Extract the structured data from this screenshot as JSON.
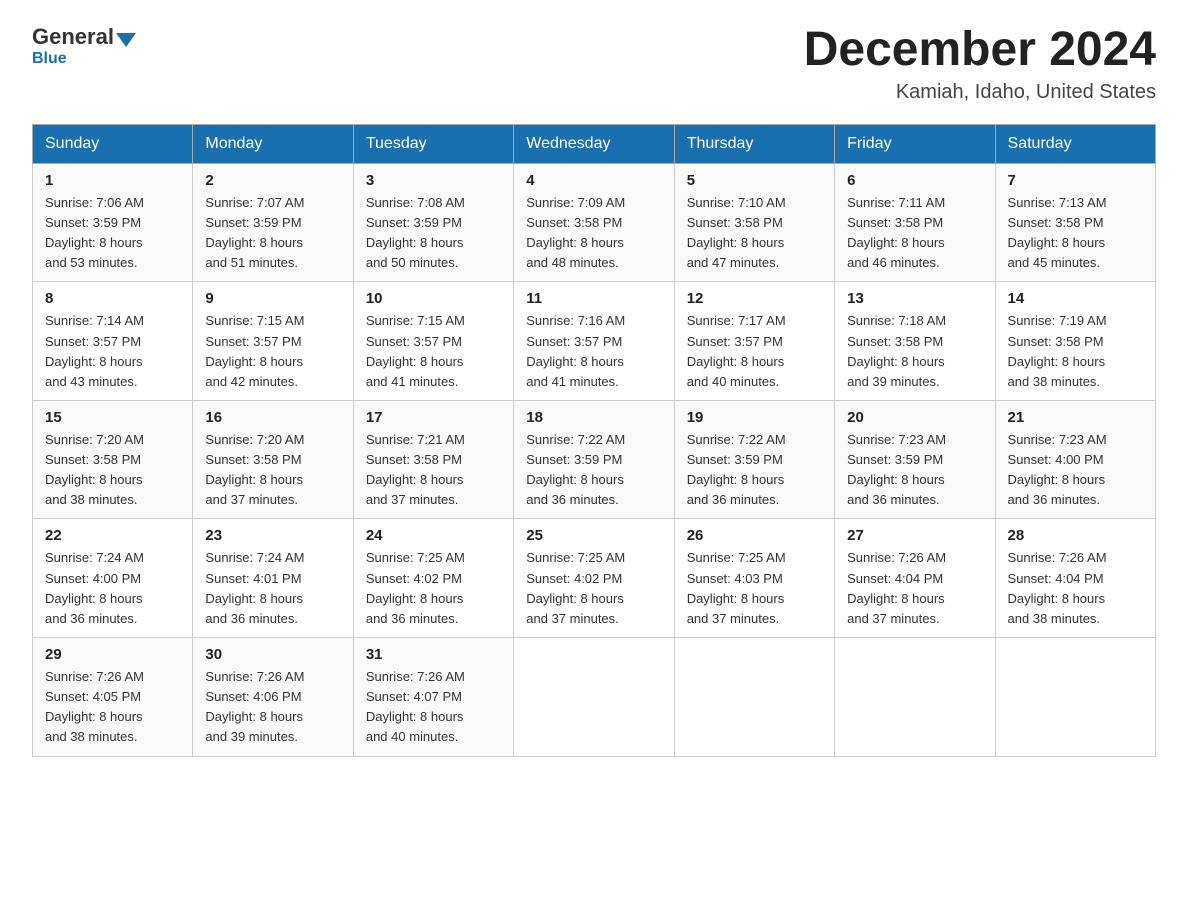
{
  "header": {
    "logo_text_general": "General",
    "logo_text_blue": "Blue",
    "month_title": "December 2024",
    "location": "Kamiah, Idaho, United States"
  },
  "days_of_week": [
    "Sunday",
    "Monday",
    "Tuesday",
    "Wednesday",
    "Thursday",
    "Friday",
    "Saturday"
  ],
  "weeks": [
    [
      {
        "day": "1",
        "sunrise": "7:06 AM",
        "sunset": "3:59 PM",
        "daylight": "8 hours and 53 minutes."
      },
      {
        "day": "2",
        "sunrise": "7:07 AM",
        "sunset": "3:59 PM",
        "daylight": "8 hours and 51 minutes."
      },
      {
        "day": "3",
        "sunrise": "7:08 AM",
        "sunset": "3:59 PM",
        "daylight": "8 hours and 50 minutes."
      },
      {
        "day": "4",
        "sunrise": "7:09 AM",
        "sunset": "3:58 PM",
        "daylight": "8 hours and 48 minutes."
      },
      {
        "day": "5",
        "sunrise": "7:10 AM",
        "sunset": "3:58 PM",
        "daylight": "8 hours and 47 minutes."
      },
      {
        "day": "6",
        "sunrise": "7:11 AM",
        "sunset": "3:58 PM",
        "daylight": "8 hours and 46 minutes."
      },
      {
        "day": "7",
        "sunrise": "7:13 AM",
        "sunset": "3:58 PM",
        "daylight": "8 hours and 45 minutes."
      }
    ],
    [
      {
        "day": "8",
        "sunrise": "7:14 AM",
        "sunset": "3:57 PM",
        "daylight": "8 hours and 43 minutes."
      },
      {
        "day": "9",
        "sunrise": "7:15 AM",
        "sunset": "3:57 PM",
        "daylight": "8 hours and 42 minutes."
      },
      {
        "day": "10",
        "sunrise": "7:15 AM",
        "sunset": "3:57 PM",
        "daylight": "8 hours and 41 minutes."
      },
      {
        "day": "11",
        "sunrise": "7:16 AM",
        "sunset": "3:57 PM",
        "daylight": "8 hours and 41 minutes."
      },
      {
        "day": "12",
        "sunrise": "7:17 AM",
        "sunset": "3:57 PM",
        "daylight": "8 hours and 40 minutes."
      },
      {
        "day": "13",
        "sunrise": "7:18 AM",
        "sunset": "3:58 PM",
        "daylight": "8 hours and 39 minutes."
      },
      {
        "day": "14",
        "sunrise": "7:19 AM",
        "sunset": "3:58 PM",
        "daylight": "8 hours and 38 minutes."
      }
    ],
    [
      {
        "day": "15",
        "sunrise": "7:20 AM",
        "sunset": "3:58 PM",
        "daylight": "8 hours and 38 minutes."
      },
      {
        "day": "16",
        "sunrise": "7:20 AM",
        "sunset": "3:58 PM",
        "daylight": "8 hours and 37 minutes."
      },
      {
        "day": "17",
        "sunrise": "7:21 AM",
        "sunset": "3:58 PM",
        "daylight": "8 hours and 37 minutes."
      },
      {
        "day": "18",
        "sunrise": "7:22 AM",
        "sunset": "3:59 PM",
        "daylight": "8 hours and 36 minutes."
      },
      {
        "day": "19",
        "sunrise": "7:22 AM",
        "sunset": "3:59 PM",
        "daylight": "8 hours and 36 minutes."
      },
      {
        "day": "20",
        "sunrise": "7:23 AM",
        "sunset": "3:59 PM",
        "daylight": "8 hours and 36 minutes."
      },
      {
        "day": "21",
        "sunrise": "7:23 AM",
        "sunset": "4:00 PM",
        "daylight": "8 hours and 36 minutes."
      }
    ],
    [
      {
        "day": "22",
        "sunrise": "7:24 AM",
        "sunset": "4:00 PM",
        "daylight": "8 hours and 36 minutes."
      },
      {
        "day": "23",
        "sunrise": "7:24 AM",
        "sunset": "4:01 PM",
        "daylight": "8 hours and 36 minutes."
      },
      {
        "day": "24",
        "sunrise": "7:25 AM",
        "sunset": "4:02 PM",
        "daylight": "8 hours and 36 minutes."
      },
      {
        "day": "25",
        "sunrise": "7:25 AM",
        "sunset": "4:02 PM",
        "daylight": "8 hours and 37 minutes."
      },
      {
        "day": "26",
        "sunrise": "7:25 AM",
        "sunset": "4:03 PM",
        "daylight": "8 hours and 37 minutes."
      },
      {
        "day": "27",
        "sunrise": "7:26 AM",
        "sunset": "4:04 PM",
        "daylight": "8 hours and 37 minutes."
      },
      {
        "day": "28",
        "sunrise": "7:26 AM",
        "sunset": "4:04 PM",
        "daylight": "8 hours and 38 minutes."
      }
    ],
    [
      {
        "day": "29",
        "sunrise": "7:26 AM",
        "sunset": "4:05 PM",
        "daylight": "8 hours and 38 minutes."
      },
      {
        "day": "30",
        "sunrise": "7:26 AM",
        "sunset": "4:06 PM",
        "daylight": "8 hours and 39 minutes."
      },
      {
        "day": "31",
        "sunrise": "7:26 AM",
        "sunset": "4:07 PM",
        "daylight": "8 hours and 40 minutes."
      },
      null,
      null,
      null,
      null
    ]
  ],
  "labels": {
    "sunrise": "Sunrise:",
    "sunset": "Sunset:",
    "daylight": "Daylight:"
  }
}
